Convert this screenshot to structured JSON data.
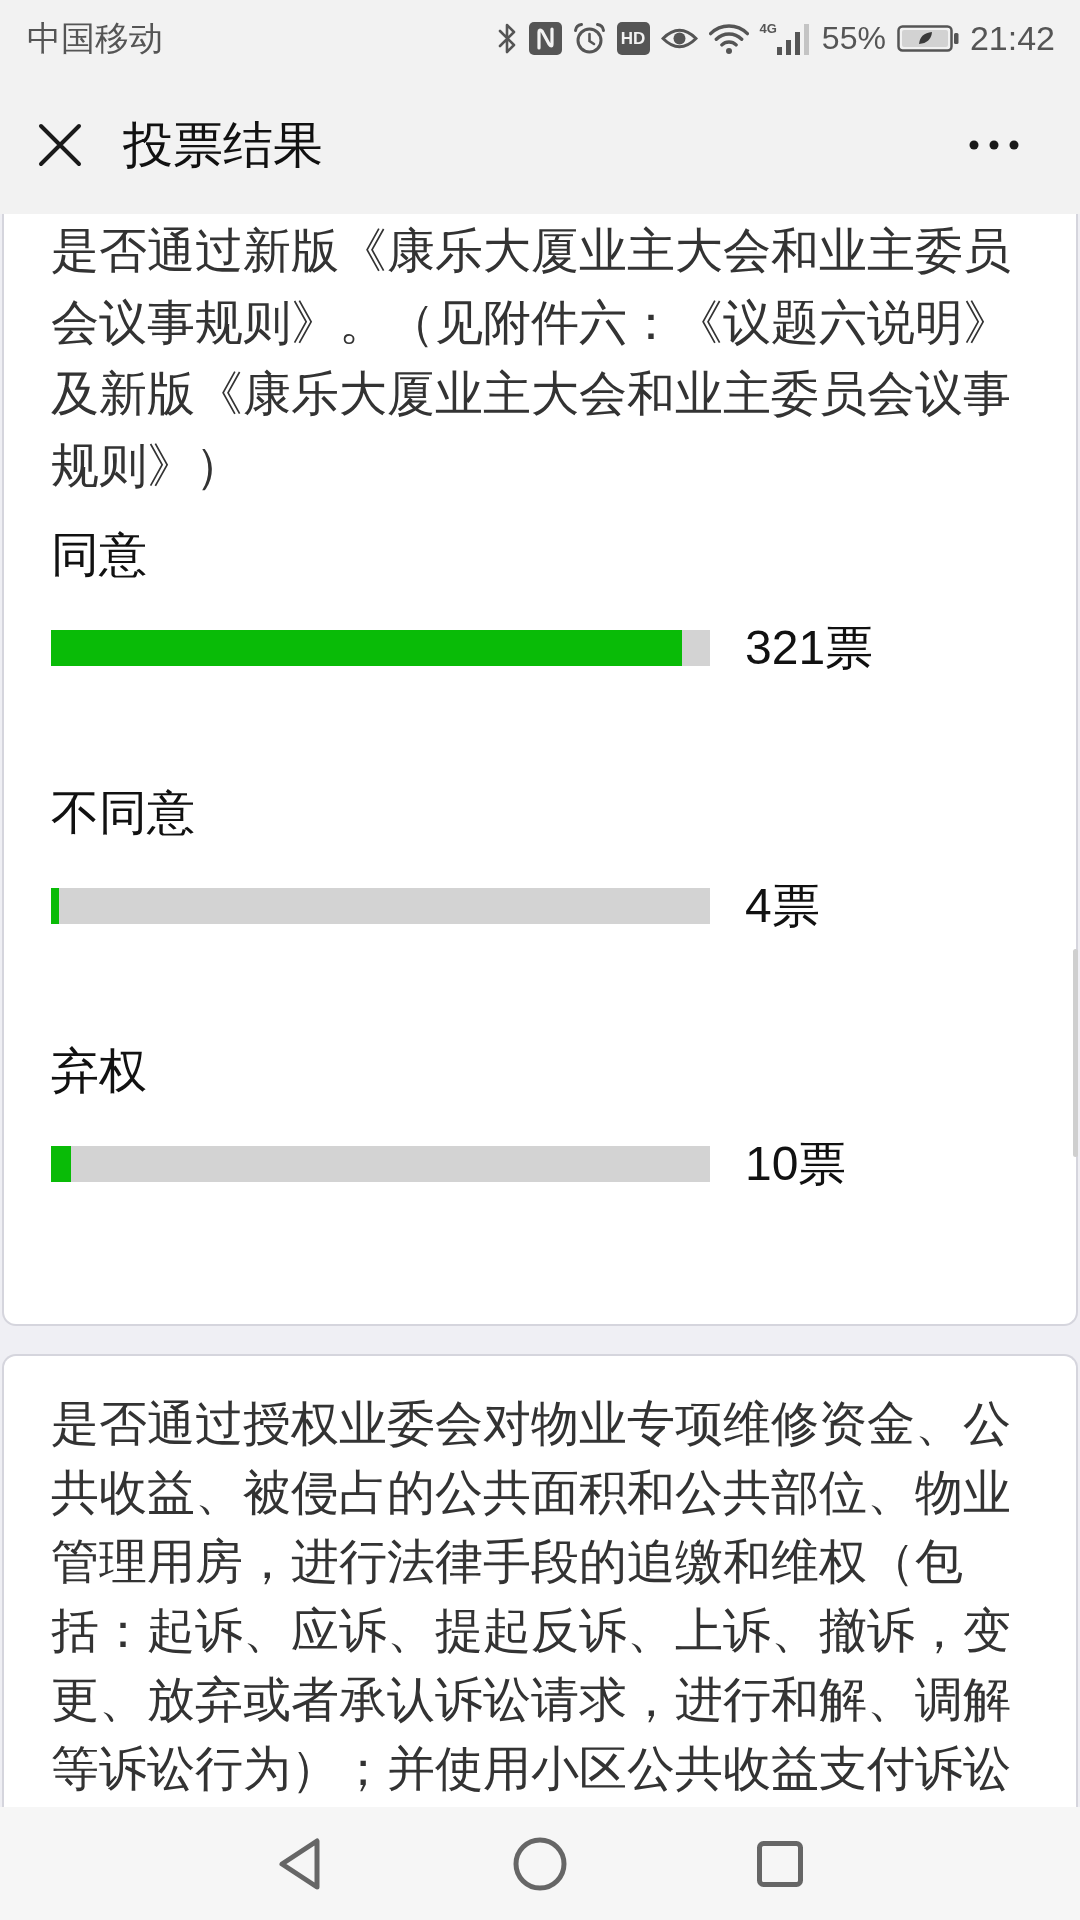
{
  "status_bar": {
    "carrier": "中国移动",
    "hd_label": "HD",
    "network_type": "4G",
    "battery": "55%",
    "time": "21:42"
  },
  "header": {
    "title": "投票结果"
  },
  "questions": [
    {
      "text": "是否通过新版《康乐大厦业主大会和业主委员会议事规则》。（见附件六：《议题六说明》及新版《康乐大厦业主大会和业主委员会议事规则》）",
      "options": [
        {
          "label": "同意",
          "level": 0.958,
          "votes": "321票"
        },
        {
          "label": "不同意",
          "level": 0.012,
          "votes": "4票"
        },
        {
          "label": "弃权",
          "level": 0.03,
          "votes": "10票"
        }
      ]
    },
    {
      "text": "是否通过授权业委会对物业专项维修资金、公共收益、被侵占的公共面积和公共部位、物业管理用房，进行法律手段的追缴和维权（包括：起诉、应诉、提起反诉、上诉、撤诉，变更、放弃或者承认诉讼请求，进行和解、调解等诉讼行为）；并使用小区公共收益支付诉讼"
    }
  ]
}
